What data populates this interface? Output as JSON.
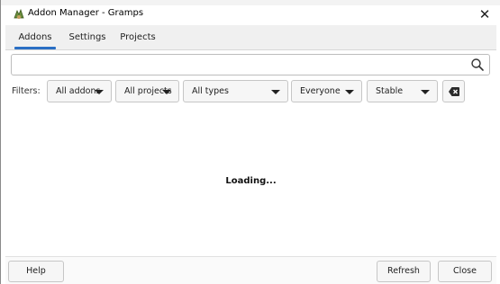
{
  "window": {
    "title": "Addon Manager - Gramps",
    "close_glyph": "✕",
    "title_icon": "gramps-logo-icon"
  },
  "tabs": [
    {
      "label": "Addons",
      "active": true
    },
    {
      "label": "Settings",
      "active": false
    },
    {
      "label": "Projects",
      "active": false
    }
  ],
  "search": {
    "value": "",
    "placeholder": "",
    "icon": "search-icon"
  },
  "filters": {
    "label": "Filters:",
    "dropdowns": [
      {
        "selected": "All addons"
      },
      {
        "selected": "All projects"
      },
      {
        "selected": "All types"
      },
      {
        "selected": "Everyone"
      },
      {
        "selected": "Stable"
      }
    ],
    "clear_icon": "clear-filters-icon"
  },
  "status": {
    "message": "Loading..."
  },
  "footer": {
    "help_label": "Help",
    "refresh_label": "Refresh",
    "close_label": "Close"
  },
  "colors": {
    "accent": "#2a6fc4"
  }
}
